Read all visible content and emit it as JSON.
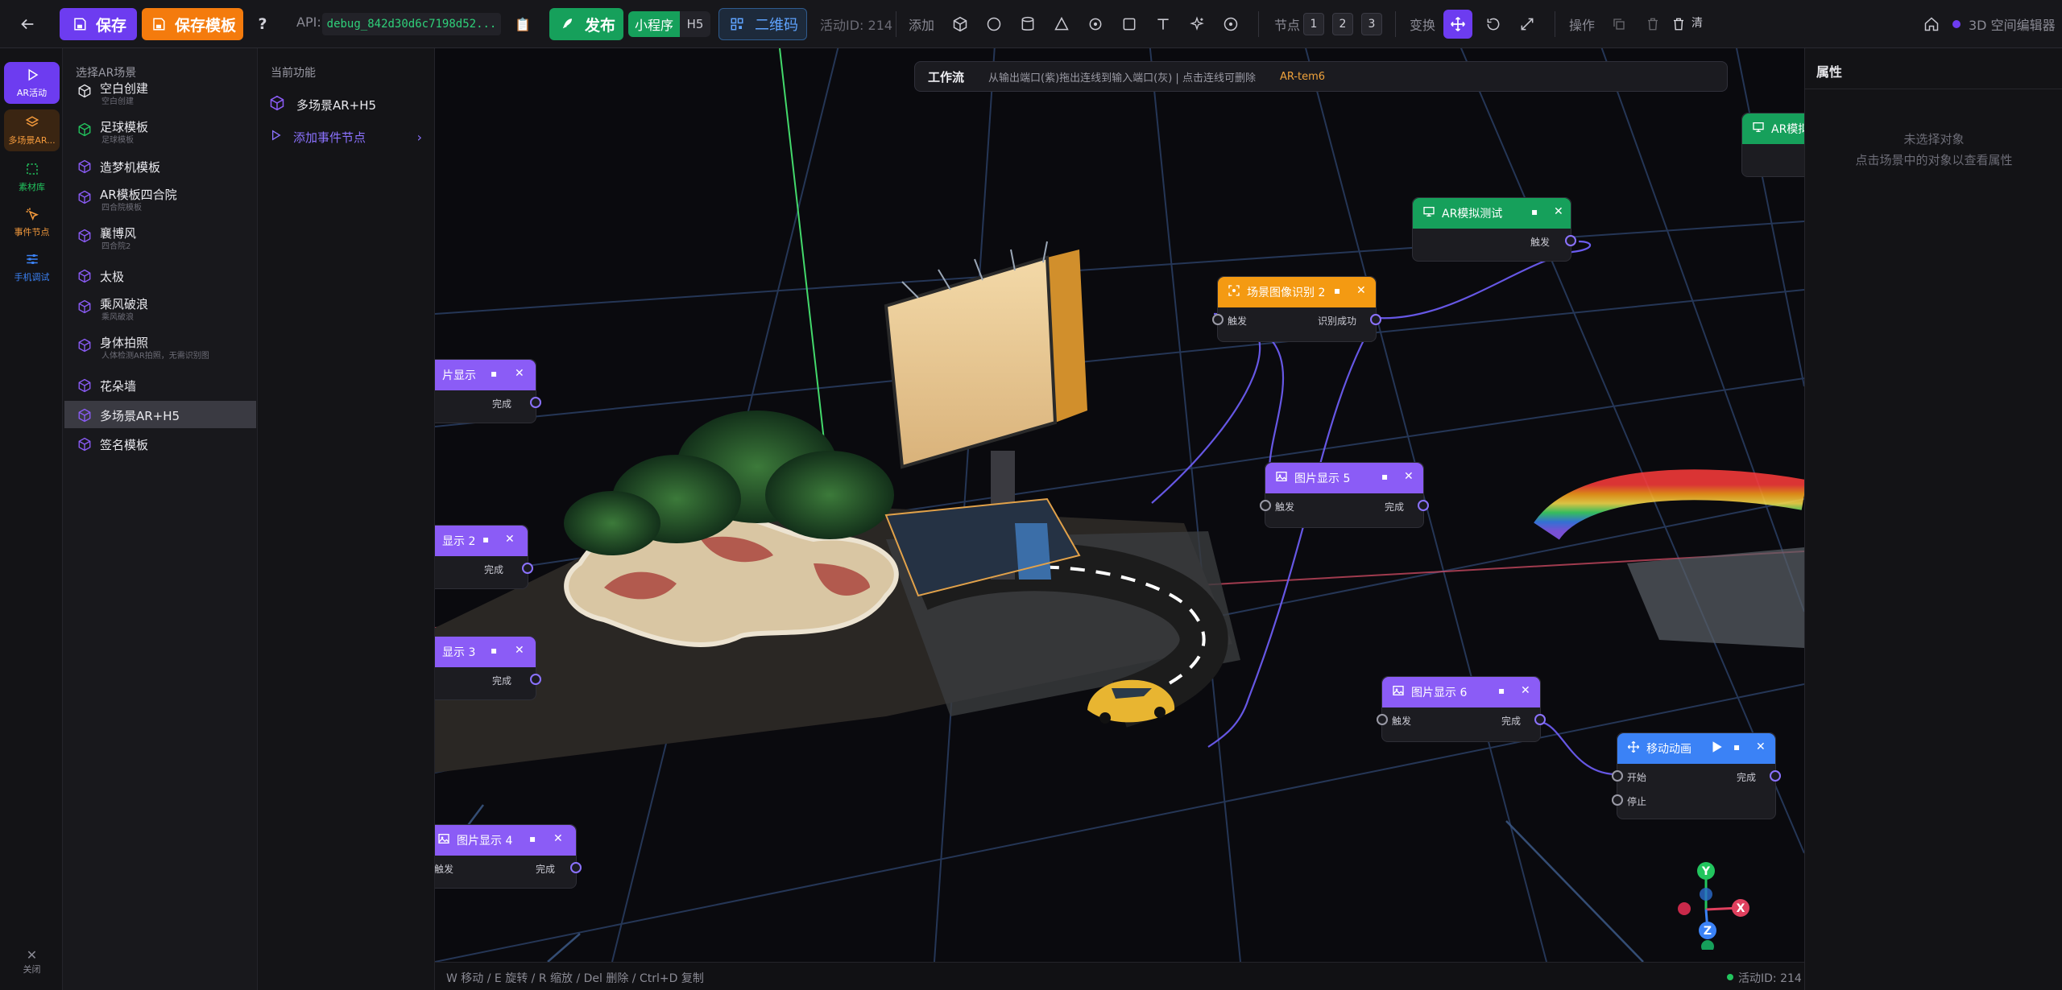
{
  "toolbar": {
    "save": "保存",
    "save_template": "保存模板",
    "help": "?",
    "api_label": "API:",
    "api_value": "debug_842d30d6c7198d52...",
    "publish": "发布",
    "mini_program": "小程序",
    "h5": "H5",
    "qrcode": "二维码",
    "activity_id": "活动ID: 214",
    "add_label": "添加",
    "node_label": "节点",
    "node_pages": [
      "1",
      "2",
      "3"
    ],
    "transform_label": "变换",
    "ops_label": "操作",
    "clear": "清",
    "editor_title": "3D 空间编辑器"
  },
  "left_nav": {
    "items": [
      {
        "label": "AR活动",
        "icon": "play-icon",
        "color": "#6d3cf0"
      },
      {
        "label": "多场景AR...",
        "icon": "layers-icon",
        "color": "#f47b0d"
      },
      {
        "label": "素材库",
        "icon": "dashed-box-icon",
        "color": "#22c55e"
      },
      {
        "label": "事件节点",
        "icon": "cursor-click-icon",
        "color": "#f47b0d"
      },
      {
        "label": "手机调试",
        "icon": "sliders-icon",
        "color": "#3b82f6"
      }
    ],
    "close_label": "关闭"
  },
  "scene_panel": {
    "title": "选择AR场景",
    "items": [
      {
        "name": "空白创建",
        "sub": "空白创建",
        "icon_color": "#e6e6ea"
      },
      {
        "name": "足球模板",
        "sub": "足球模板",
        "icon_color": "#22c55e"
      },
      {
        "name": "造梦机模板",
        "sub": "",
        "icon_color": "#8b5cf6"
      },
      {
        "name": "AR模板四合院",
        "sub": "四合院模板",
        "icon_color": "#8b5cf6"
      },
      {
        "name": "襄博风",
        "sub": "四合院2",
        "icon_color": "#8b5cf6"
      },
      {
        "name": "太极",
        "sub": "",
        "icon_color": "#8b5cf6"
      },
      {
        "name": "乘风破浪",
        "sub": "乘风破浪",
        "icon_color": "#8b5cf6"
      },
      {
        "name": "身体拍照",
        "sub": "人体检测AR拍照，无需识别图",
        "icon_color": "#8b5cf6"
      },
      {
        "name": "花朵墙",
        "sub": "",
        "icon_color": "#8b5cf6"
      },
      {
        "name": "多场景AR+H5",
        "sub": "",
        "icon_color": "#8b5cf6",
        "selected": true
      },
      {
        "name": "签名模板",
        "sub": "",
        "icon_color": "#8b5cf6"
      }
    ]
  },
  "func_panel": {
    "title": "当前功能",
    "current": "多场景AR+H5",
    "add_event": "添加事件节点"
  },
  "workflow": {
    "title": "工作流",
    "hint": "从输出端口(紫)拖出连线到输入端口(灰) | 点击连线可删除",
    "tag": "AR-tem6"
  },
  "nodes": {
    "img_show_top": {
      "title": "片显示",
      "out": "完成"
    },
    "show2": {
      "title": "显示 2",
      "out": "完成"
    },
    "show3": {
      "title": "显示 3",
      "out": "完成"
    },
    "show4": {
      "title": "图片显示 4",
      "in": "触发",
      "out": "完成"
    },
    "ar_test": {
      "title": "AR模拟测试",
      "in": "触发"
    },
    "ar_test2": {
      "title": "AR模拟"
    },
    "recog2": {
      "title": "场景图像识别 2",
      "in": "触发",
      "out": "识别成功"
    },
    "show5": {
      "title": "图片显示 5",
      "in": "触发",
      "out": "完成"
    },
    "show6": {
      "title": "图片显示 6",
      "in": "触发",
      "out": "完成"
    },
    "move_anim": {
      "title": "移动动画",
      "in1": "开始",
      "in2": "停止",
      "out": "完成"
    }
  },
  "gizmo": {
    "x": "X",
    "y": "Y",
    "z": "Z"
  },
  "statusbar": {
    "hint": "W 移动 / E 旋转 / R 缩放 / Del 删除 / Ctrl+D 复制",
    "activity": "活动ID: 214"
  },
  "props": {
    "title": "属性",
    "empty1": "未选择对象",
    "empty2": "点击场景中的对象以查看属性"
  },
  "colors": {
    "purple": "#6d3cf0",
    "orange": "#f47b0d",
    "green": "#16a05b",
    "blue": "#3b82f6",
    "node_purple": "#8b5cf6"
  }
}
